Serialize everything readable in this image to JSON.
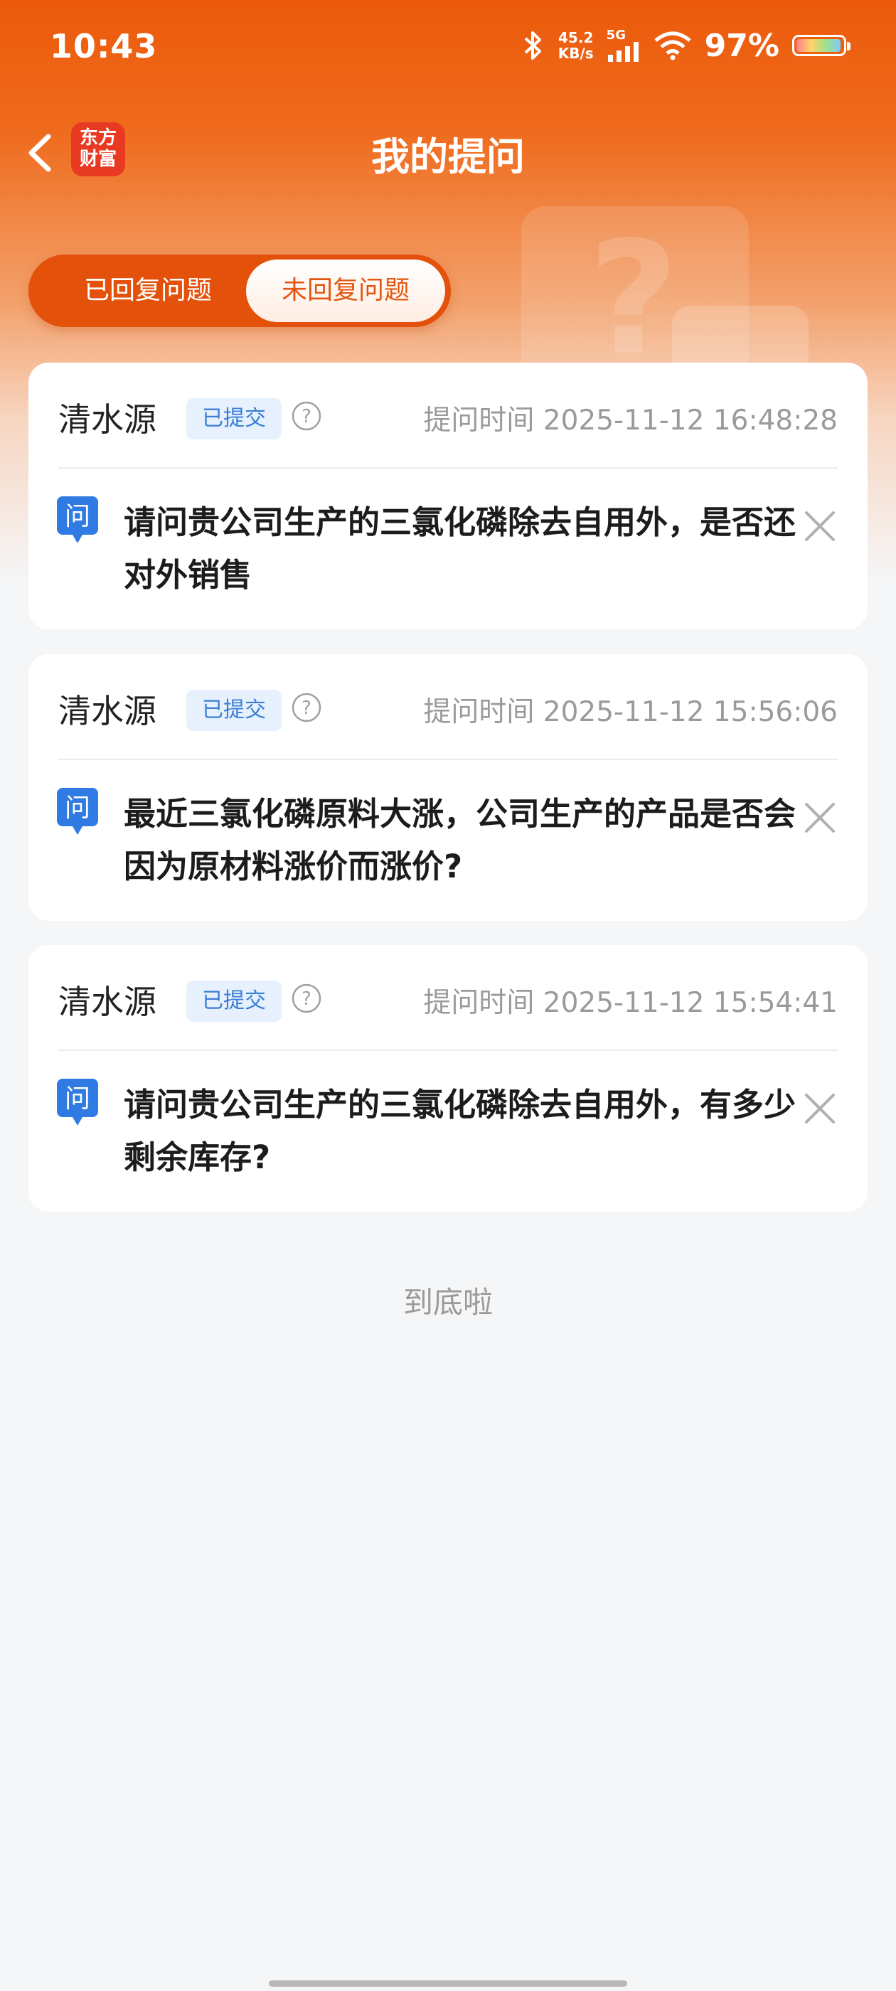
{
  "status_bar": {
    "time": "10:43",
    "network_speed_value": "45.2",
    "network_speed_unit": "KB/s",
    "network_type": "5G",
    "battery_percent": "97%",
    "battery_level": 0.97
  },
  "header": {
    "title": "我的提问",
    "logo_line1": "东方",
    "logo_line2": "财富"
  },
  "tabs": [
    {
      "label": "已回复问题",
      "active": false
    },
    {
      "label": "未回复问题",
      "active": true
    }
  ],
  "colors": {
    "brand_orange": "#ec5a0b",
    "badge_blue": "#3a7dd6",
    "tab_active_text": "#e4560f"
  },
  "questions": [
    {
      "user": "清水源",
      "status": "已提交",
      "time": "提问时间 2025-11-12 16:48:28",
      "question_icon": "问",
      "text": "请问贵公司生产的三氯化磷除去自用外，是否还对外销售"
    },
    {
      "user": "清水源",
      "status": "已提交",
      "time": "提问时间 2025-11-12 15:56:06",
      "question_icon": "问",
      "text": "最近三氯化磷原料大涨，公司生产的产品是否会因为原材料涨价而涨价?"
    },
    {
      "user": "清水源",
      "status": "已提交",
      "time": "提问时间 2025-11-12 15:54:41",
      "question_icon": "问",
      "text": "请问贵公司生产的三氯化磷除去自用外，有多少剩余库存?"
    }
  ],
  "list_end_text": "到底啦",
  "icons": [
    "back-arrow-icon",
    "help-circle-icon",
    "question-bubble-icon",
    "close-icon",
    "bluetooth-icon",
    "signal-icon",
    "wifi-icon",
    "battery-icon"
  ]
}
